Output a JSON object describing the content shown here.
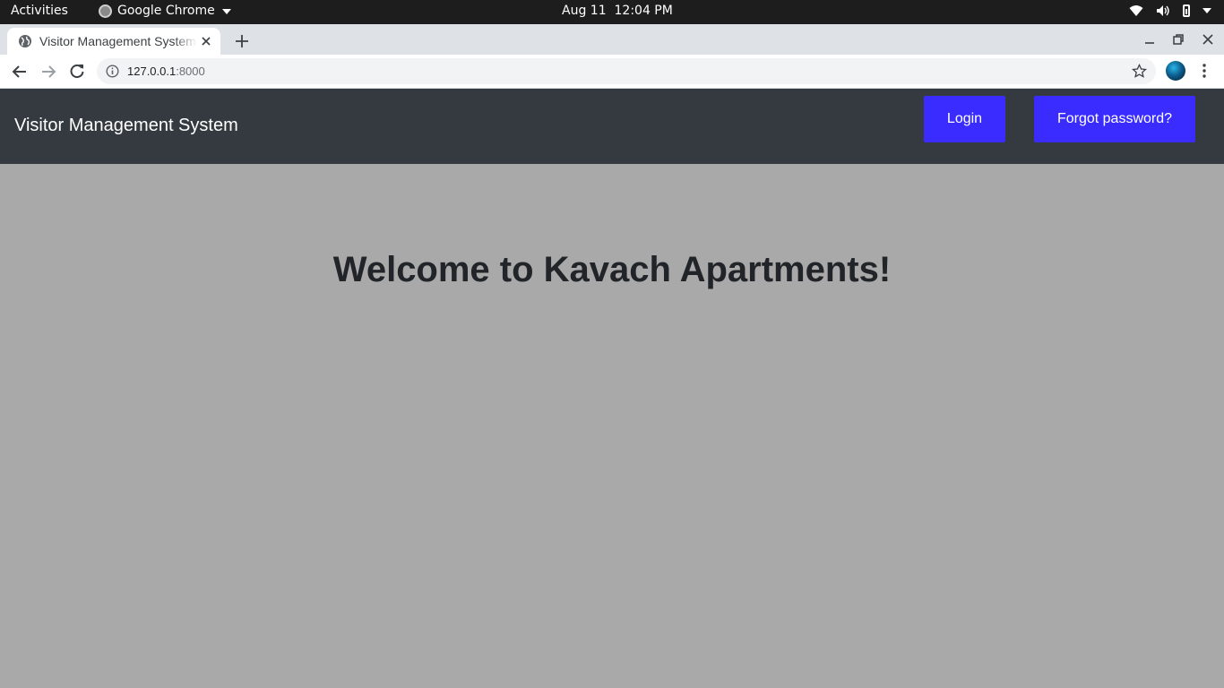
{
  "system_bar": {
    "activities": "Activities",
    "app_name": "Google Chrome",
    "clock": "Aug 11  12:04 PM"
  },
  "browser": {
    "tab_title": "Visitor Management System",
    "url_host": "127.0.0.1",
    "url_port": ":8000"
  },
  "navbar": {
    "brand": "Visitor Management System",
    "login_label": "Login",
    "forgot_label": "Forgot password?"
  },
  "main": {
    "heading": "Welcome to Kavach Apartments!"
  },
  "colors": {
    "navbar_bg": "#343a40",
    "button_bg": "#3a2cff",
    "page_bg": "#a9a9a9"
  }
}
